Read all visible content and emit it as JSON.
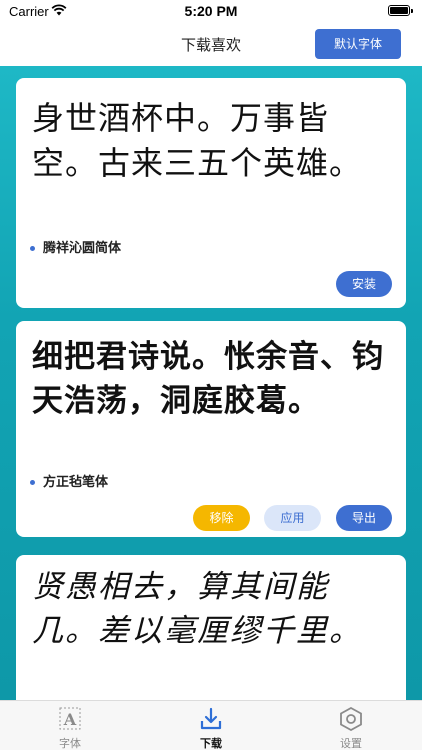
{
  "status_bar": {
    "carrier": "Carrier",
    "time": "5:20 PM"
  },
  "nav": {
    "title": "下载喜欢",
    "default_font_button": "默认字体"
  },
  "cards": [
    {
      "sample_text": "身世酒杯中。万事皆空。古来三五个英雄。",
      "font_name": "腾祥沁圆简体",
      "install_label": "安装"
    },
    {
      "sample_text": "细把君诗说。怅余音、钧天浩荡，洞庭胶葛。",
      "font_name": "方正毡笔体",
      "remove_label": "移除",
      "apply_label": "应用",
      "export_label": "导出"
    },
    {
      "sample_text": "贤愚相去，算其间能几。差以毫厘缪千里。"
    }
  ],
  "tabs": [
    {
      "label": "字体",
      "icon": "font-icon",
      "active": false
    },
    {
      "label": "下载",
      "icon": "download-icon",
      "active": true
    },
    {
      "label": "设置",
      "icon": "settings-icon",
      "active": false
    }
  ],
  "colors": {
    "accent": "#3e6fd1",
    "warning": "#f5b700",
    "background_teal": "#1eb8c6"
  }
}
